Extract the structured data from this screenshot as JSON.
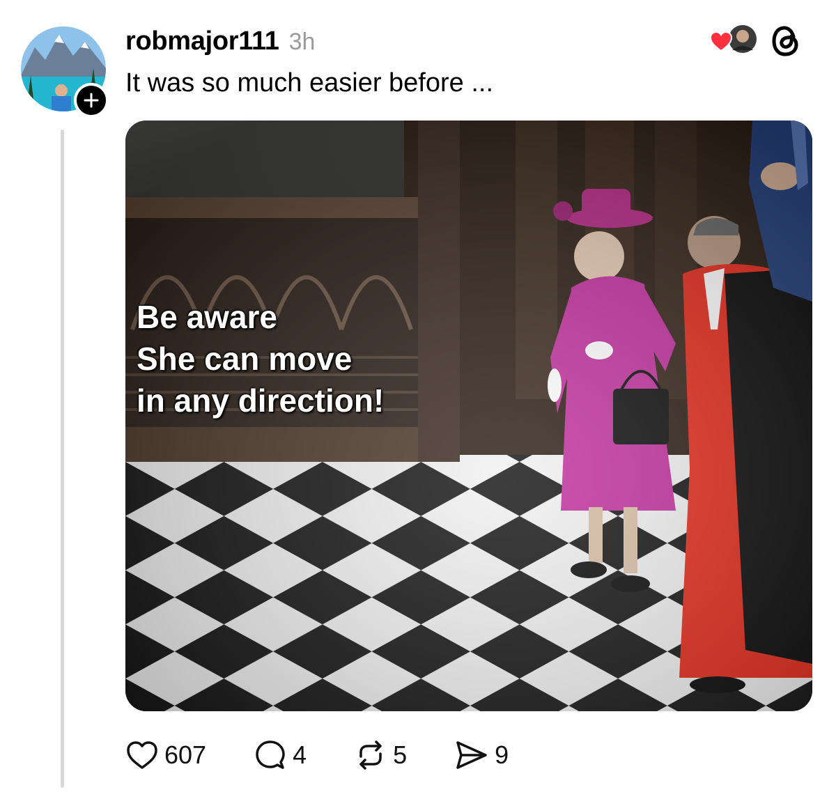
{
  "post": {
    "username": "robmajor111",
    "time": "3h",
    "text": "It was so much easier before ...",
    "image_overlay": [
      "Be aware",
      "She can move",
      "in any direction!"
    ]
  },
  "actions": {
    "likes": "607",
    "replies": "4",
    "reposts": "5",
    "shares": "9"
  },
  "colors": {
    "like_heart": "#ff3040",
    "thread_line": "#d9d9d9",
    "coat_magenta": "#c2309e",
    "robe_red": "#e52a1b"
  },
  "icons": [
    "plus-icon",
    "heart-icon",
    "threads-logo-icon",
    "reply-icon",
    "repost-icon",
    "share-icon"
  ]
}
